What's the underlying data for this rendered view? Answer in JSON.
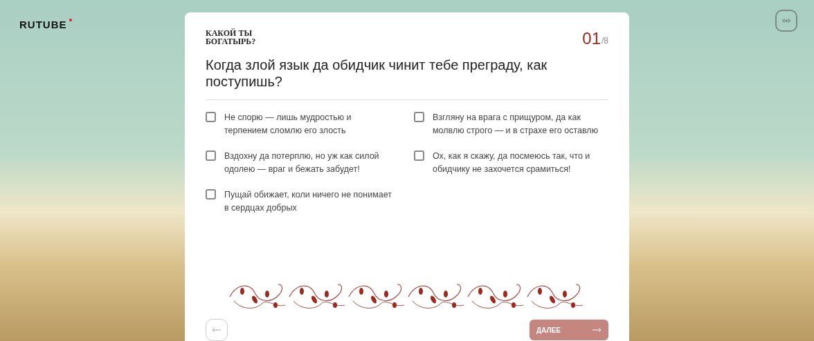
{
  "logo": {
    "text": "RUTUBE"
  },
  "quiz": {
    "title": "КАКОЙ ТЫ БОГАТЫРЬ?",
    "counter": {
      "current": "01",
      "total": "/8"
    },
    "question": "Когда злой язык да обидчик чинит тебе преграду, как поступишь?",
    "options": [
      {
        "text": "Не спорю — лишь мудростью и терпением сломлю его злость",
        "checked": false
      },
      {
        "text": "Взгляну на врага с прищуром, да как молвлю строго — и в страхе его оставлю",
        "checked": false
      },
      {
        "text": "Вздохну да потерплю, но уж как силой одолею — враг и бежать забудет!",
        "checked": false
      },
      {
        "text": "Ох, как я скажу, да посмеюсь так, что и обидчику не захочется срамиться!",
        "checked": false
      },
      {
        "text": "Пущай обижает, коли ничего не понимает в сердцах добрых",
        "checked": false
      }
    ],
    "next_button": {
      "label": "ДАЛЕЕ",
      "disabled": true
    }
  }
}
